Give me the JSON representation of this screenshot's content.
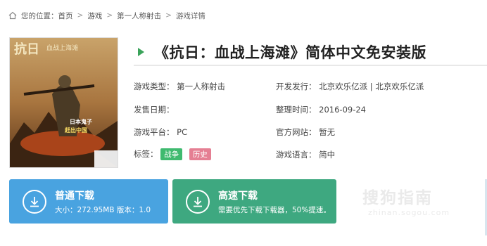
{
  "breadcrumb": {
    "label": "您的位置：",
    "items": [
      "首页",
      "游戏",
      "第一人称射击",
      "游戏详情"
    ],
    "separator": ">"
  },
  "cover": {
    "title_lettering": "抗日 血战上海滩",
    "slogan_lettering": "日本鬼子 赶出中国"
  },
  "title": "《抗日：血战上海滩》简体中文免安装版",
  "details": {
    "type_label": "游戏类型：",
    "type_value": "第一人称射击",
    "dev_label": "开发发行：",
    "dev_value": "北京欢乐亿派 | 北京欢乐亿派",
    "release_label": "发售日期：",
    "release_value": "",
    "organize_label": "整理时间：",
    "organize_value": "2016-09-24",
    "platform_label": "游戏平台：",
    "platform_value": "PC",
    "site_label": "官方网站：",
    "site_value": "暂无",
    "tags_label": "标签：",
    "tags": [
      {
        "text": "战争",
        "color": "#3fba6f"
      },
      {
        "text": "历史",
        "color": "#e57f93"
      }
    ],
    "lang_label": "游戏语言：",
    "lang_value": "简中"
  },
  "buttons": {
    "normal": {
      "title": "普通下载",
      "sub": "大小：272.95MB  版本：1.0",
      "color": "#49a3e0"
    },
    "fast": {
      "title": "高速下载",
      "sub": "需要优先下载下载器，50%提速。",
      "color": "#3ea880"
    }
  },
  "watermark": {
    "main": "搜狗指南",
    "sub": "zhinan.sogou.com"
  }
}
